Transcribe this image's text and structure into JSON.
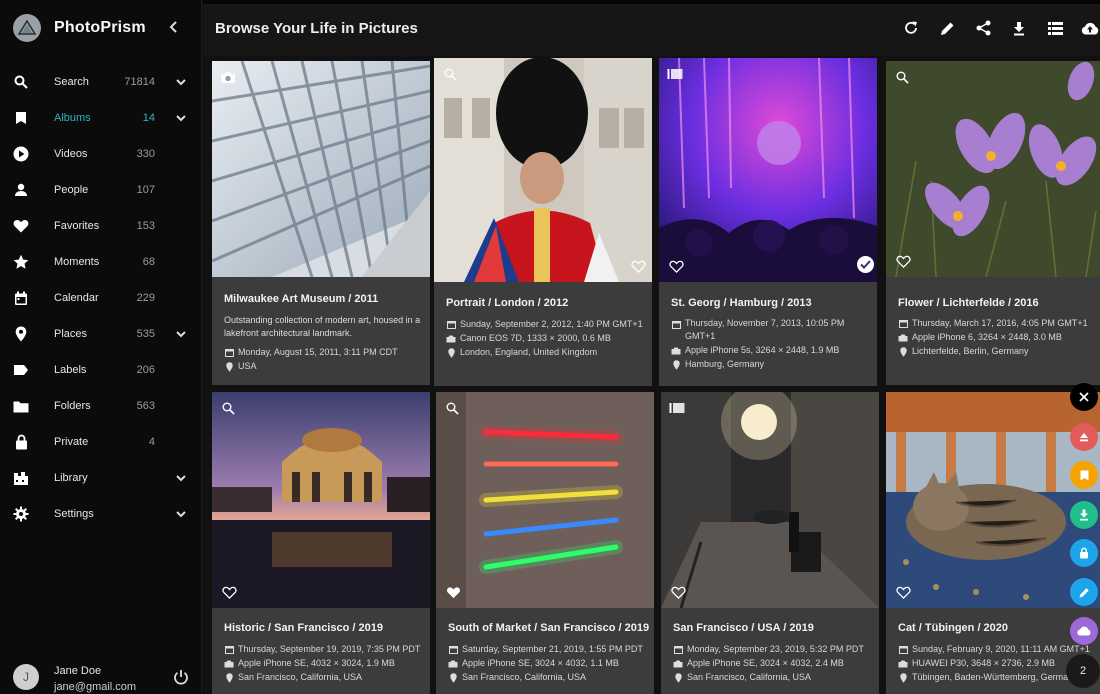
{
  "app": {
    "name": "PhotoPrism"
  },
  "sidebar": {
    "items": [
      {
        "label": "Search",
        "count": "71814",
        "icon": "search-icon"
      },
      {
        "label": "Albums",
        "count": "14",
        "icon": "bookmark-icon"
      },
      {
        "label": "Videos",
        "count": "330",
        "icon": "play-circle-icon"
      },
      {
        "label": "People",
        "count": "107",
        "icon": "person-icon"
      },
      {
        "label": "Favorites",
        "count": "153",
        "icon": "heart-icon"
      },
      {
        "label": "Moments",
        "count": "68",
        "icon": "star-icon"
      },
      {
        "label": "Calendar",
        "count": "229",
        "icon": "calendar-icon"
      },
      {
        "label": "Places",
        "count": "535",
        "icon": "place-icon"
      },
      {
        "label": "Labels",
        "count": "206",
        "icon": "label-icon"
      },
      {
        "label": "Folders",
        "count": "563",
        "icon": "folder-icon"
      },
      {
        "label": "Private",
        "count": "4",
        "icon": "lock-icon"
      },
      {
        "label": "Library",
        "count": "",
        "icon": "library-icon"
      },
      {
        "label": "Settings",
        "count": "",
        "icon": "gear-icon"
      }
    ],
    "active": "Albums",
    "user": {
      "initial": "J",
      "name": "Jane Doe",
      "email": "jane@gmail.com"
    }
  },
  "header": {
    "title": "Browse Your Life in Pictures"
  },
  "colors": {
    "accent": "#2fb5bd",
    "card": "#3c3c3c",
    "sidebar": "#0b0b0b"
  },
  "cards": [
    {
      "title": "Milwaukee Art Museum / 2011",
      "description": "Outstanding collection of modern art, housed in a lakefront architectural landmark.",
      "meta": [
        "Monday, August 15, 2011, 3:11 PM CDT",
        "USA"
      ]
    },
    {
      "title": "Portrait / London / 2012",
      "meta": [
        "Sunday, September 2, 2012, 1:40 PM GMT+1",
        "Canon EOS 7D, 1333 × 2000, 0.6 MB",
        "London, England, United Kingdom"
      ]
    },
    {
      "title": "St. Georg / Hamburg / 2013",
      "meta": [
        "Thursday, November 7, 2013, 10:05 PM GMT+1",
        "Apple iPhone 5s, 3264 × 2448, 1.9 MB",
        "Hamburg, Germany"
      ]
    },
    {
      "title": "Flower / Lichterfelde / 2016",
      "meta": [
        "Thursday, March 17, 2016, 4:05 PM GMT+1",
        "Apple iPhone 6, 3264 × 2448, 3.0 MB",
        "Lichterfelde, Berlin, Germany"
      ]
    },
    {
      "title": "Historic / San Francisco / 2019",
      "meta": [
        "Thursday, September 19, 2019, 7:35 PM PDT",
        "Apple iPhone SE, 4032 × 3024, 1.9 MB",
        "San Francisco, California, USA"
      ]
    },
    {
      "title": "South of Market / San Francisco / 2019",
      "meta": [
        "Saturday, September 21, 2019, 1:55 PM PDT",
        "Apple iPhone SE, 3024 × 4032, 1.1 MB",
        "San Francisco, California, USA"
      ]
    },
    {
      "title": "San Francisco / USA / 2019",
      "meta": [
        "Monday, September 23, 2019, 5:32 PM PDT",
        "Apple iPhone SE, 3024 × 4032, 2.4 MB",
        "San Francisco, California, USA"
      ]
    },
    {
      "title": "Cat / Tübingen / 2020",
      "meta": [
        "Sunday, February 9, 2020, 11:11 AM GMT+1",
        "HUAWEI P30, 3648 × 2736, 2.9 MB",
        "Tübingen, Baden-Württemberg, Germany"
      ]
    }
  ],
  "speed_dial": {
    "count": "2"
  }
}
